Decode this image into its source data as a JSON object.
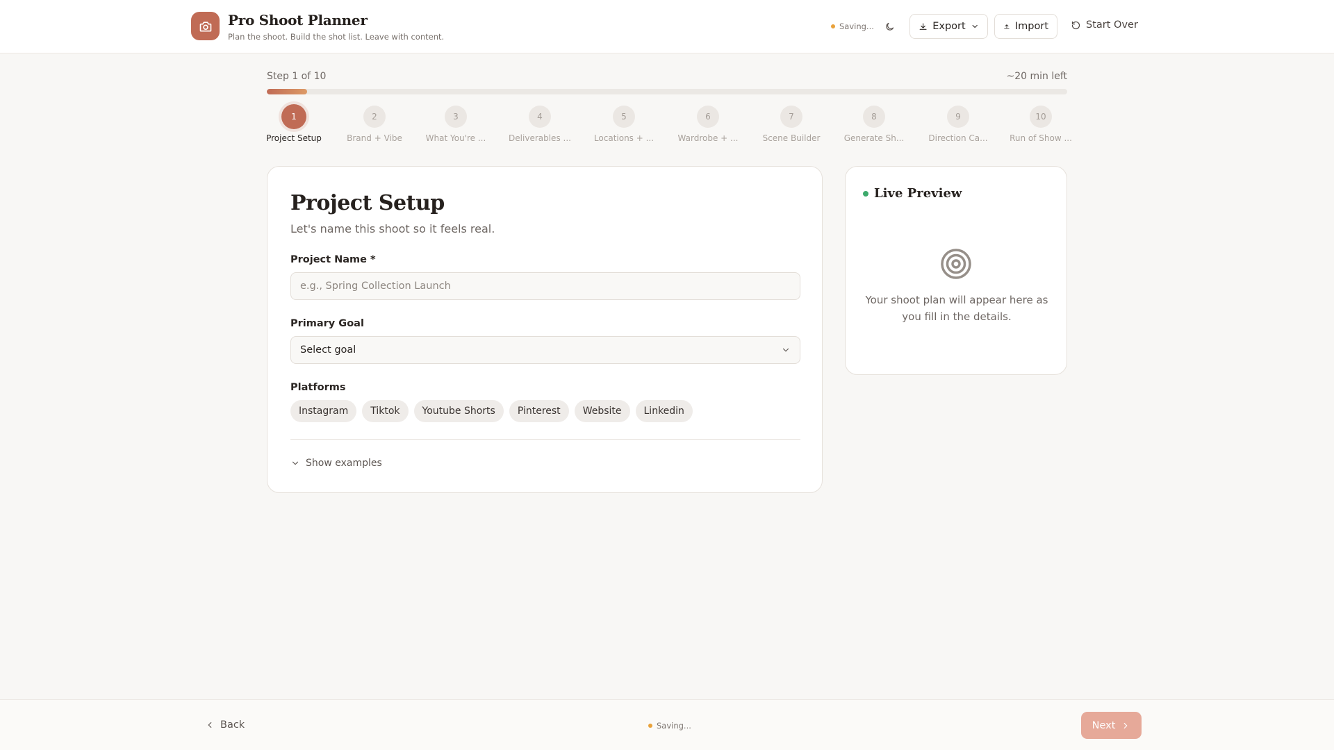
{
  "app": {
    "title": "Pro Shoot Planner",
    "subtitle": "Plan the shoot. Build the shot list. Leave with content.",
    "logo_icon": "camera-icon",
    "brand_color": "#c06b55"
  },
  "header": {
    "status": "Saving...",
    "theme_icon": "moon-icon",
    "export_label": "Export",
    "import_label": "Import",
    "start_over_label": "Start Over"
  },
  "progress": {
    "step_text": "Step 1 of 10",
    "time_left": "~20 min left",
    "fraction": 0.05,
    "current_step": 1,
    "steps": [
      {
        "num": "1",
        "label": "Project Setup"
      },
      {
        "num": "2",
        "label": "Brand + Vibe"
      },
      {
        "num": "3",
        "label": "What You're ..."
      },
      {
        "num": "4",
        "label": "Deliverables ..."
      },
      {
        "num": "5",
        "label": "Locations + ..."
      },
      {
        "num": "6",
        "label": "Wardrobe + ..."
      },
      {
        "num": "7",
        "label": "Scene Builder"
      },
      {
        "num": "8",
        "label": "Generate Sh..."
      },
      {
        "num": "9",
        "label": "Direction Ca..."
      },
      {
        "num": "10",
        "label": "Run of Show ..."
      }
    ]
  },
  "form": {
    "title": "Project Setup",
    "subtitle": "Let's name this shoot so it feels real.",
    "project_name": {
      "label": "Project Name *",
      "value": "",
      "placeholder": "e.g., Spring Collection Launch"
    },
    "primary_goal": {
      "label": "Primary Goal",
      "value": "Select goal"
    },
    "platforms": {
      "label": "Platforms",
      "options": [
        "Instagram",
        "Tiktok",
        "Youtube Shorts",
        "Pinterest",
        "Website",
        "Linkedin"
      ]
    },
    "show_examples": "Show examples"
  },
  "preview": {
    "title": "Live Preview",
    "icon": "target-icon",
    "empty_text": "Your shoot plan will appear here as you fill in the details."
  },
  "footer": {
    "back_label": "Back",
    "status": "Saving...",
    "next_label": "Next"
  }
}
